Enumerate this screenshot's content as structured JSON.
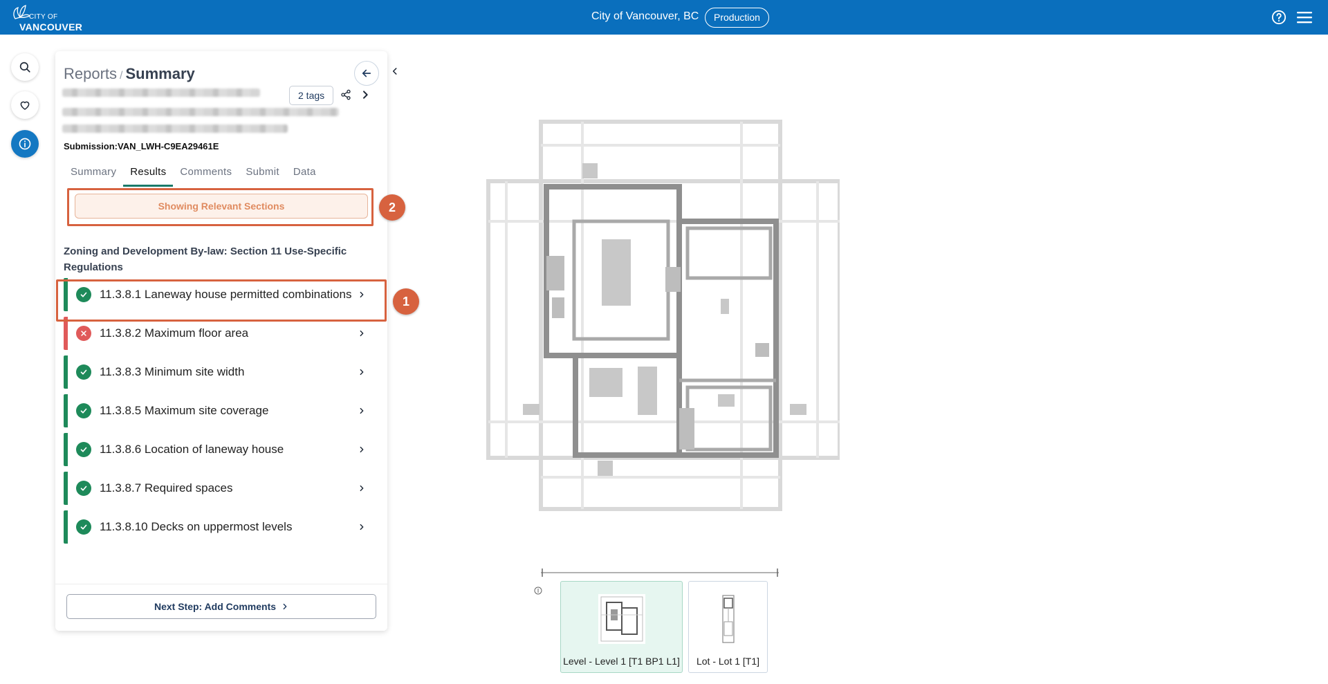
{
  "header": {
    "logo_line1": "CITY OF",
    "logo_line2": "VANCOUVER",
    "city": "City of Vancouver, BC",
    "environment": "Production"
  },
  "panel": {
    "breadcrumb": {
      "parent": "Reports",
      "separator": "/",
      "current": "Summary"
    },
    "tags_label": "2 tags",
    "submission": "Submission:VAN_LWH-C9EA29461E",
    "tabs": [
      {
        "label": "Summary"
      },
      {
        "label": "Results"
      },
      {
        "label": "Comments"
      },
      {
        "label": "Submit"
      },
      {
        "label": "Data"
      }
    ],
    "active_tab": "Results",
    "relevant_button": "Showing Relevant Sections",
    "section_heading": "Zoning and Development By-law: Section 11 Use-Specific Regulations",
    "items": [
      {
        "label": "11.3.8.1 Laneway house permitted combinations",
        "status": "pass"
      },
      {
        "label": "11.3.8.2 Maximum floor area",
        "status": "fail"
      },
      {
        "label": "11.3.8.3 Minimum site width",
        "status": "pass"
      },
      {
        "label": "11.3.8.5 Maximum site coverage",
        "status": "pass"
      },
      {
        "label": "11.3.8.6 Location of laneway house",
        "status": "pass"
      },
      {
        "label": "11.3.8.7 Required spaces",
        "status": "pass"
      },
      {
        "label": "11.3.8.10 Decks on uppermost levels",
        "status": "pass"
      }
    ],
    "next_step": "Next Step: Add Comments"
  },
  "annotations": [
    {
      "number": "1"
    },
    {
      "number": "2"
    }
  ],
  "viewer": {
    "thumbnails": [
      {
        "label": "Level - Level 1 [T1 BP1 L1]",
        "selected": true
      },
      {
        "label": "Lot - Lot 1 [T1]",
        "selected": false
      }
    ]
  },
  "colors": {
    "brand": "#0a6fbd",
    "pass": "#1e8a5a",
    "fail": "#e05a5a",
    "highlight": "#d7623f",
    "tab_underline": "#1a7a6a"
  }
}
